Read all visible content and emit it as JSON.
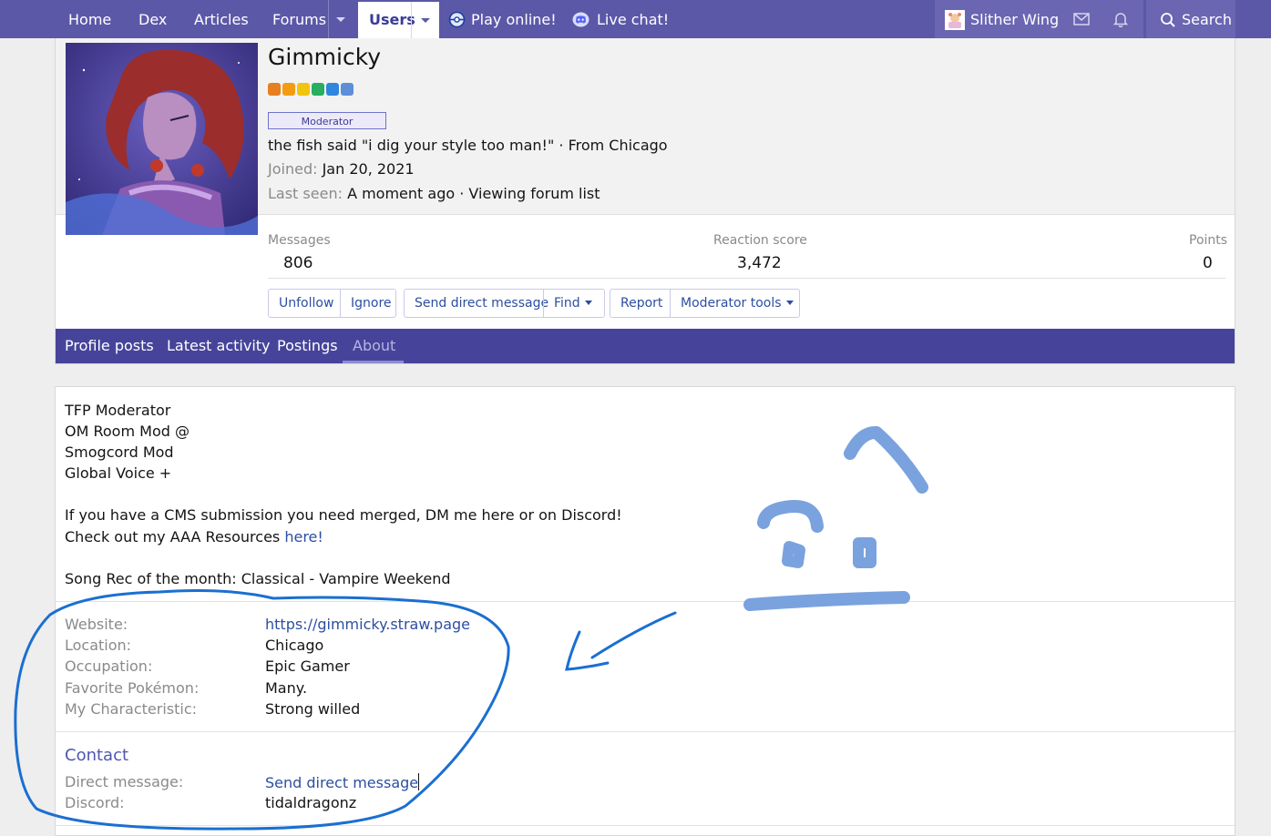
{
  "nav": {
    "home": "Home",
    "dex": "Dex",
    "articles": "Articles",
    "forums": "Forums",
    "users": "Users",
    "play_online": "Play online!",
    "live_chat": "Live chat!",
    "account_name": "Slither Wing",
    "search": "Search"
  },
  "profile": {
    "username": "Gimmicky",
    "badge": "Moderator",
    "blurb": "the fish said \"i dig your style too man!\" · From Chicago",
    "joined_label": "Joined:",
    "joined_value": "Jan 20, 2021",
    "last_seen_label": "Last seen:",
    "last_seen_value": "A moment ago · Viewing forum list",
    "stats": [
      {
        "label": "Messages",
        "value": "806"
      },
      {
        "label": "Reaction score",
        "value": "3,472"
      },
      {
        "label": "Points",
        "value": "0"
      }
    ],
    "buttons": {
      "unfollow": "Unfollow",
      "ignore": "Ignore",
      "send_dm": "Send direct message",
      "find": "Find",
      "report": "Report",
      "moderator_tools": "Moderator tools"
    },
    "tabs": [
      "Profile posts",
      "Latest activity",
      "Postings",
      "About"
    ],
    "active_tab": "About"
  },
  "about": {
    "signature_lines": [
      "TFP Moderator",
      "OM Room Mod @",
      "Smogcord Mod",
      "Global Voice +"
    ],
    "cms_line": "If you have a CMS submission you need merged, DM me here or on Discord!",
    "resources_prefix": "Check out my AAA Resources ",
    "resources_link": "here!",
    "song_line": "Song Rec of the month: Classical - Vampire Weekend",
    "fields": [
      {
        "label": "Website:",
        "value": "https://gimmicky.straw.page"
      },
      {
        "label": "Location:",
        "value": "Chicago"
      },
      {
        "label": "Occupation:",
        "value": "Epic Gamer"
      },
      {
        "label": "Favorite Pokémon:",
        "value": "Many."
      },
      {
        "label": "My Characteristic:",
        "value": "Strong willed"
      }
    ],
    "contact_heading": "Contact",
    "contact": [
      {
        "label": "Direct message:",
        "value": "Send direct message"
      },
      {
        "label": "Discord:",
        "value": "tidaldragonz"
      }
    ]
  },
  "colors": {
    "nav_bg": "#5c58a8",
    "tab_bar_bg": "#46449a",
    "link": "#2c4ea1",
    "annotation_circle": "#1a6fd1",
    "annotation_drawing": "#7aa2de"
  }
}
